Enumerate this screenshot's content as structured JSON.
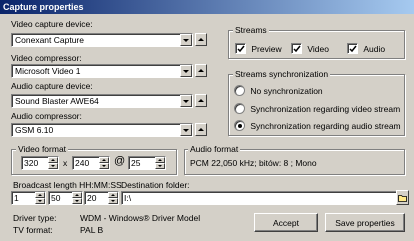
{
  "window": {
    "title": "Capture properties"
  },
  "video_device": {
    "label": "Video capture device:",
    "value": "Conexant Capture"
  },
  "video_compressor": {
    "label": "Video compressor:",
    "value": "Microsoft Video 1"
  },
  "audio_device": {
    "label": "Audio capture device:",
    "value": "Sound Blaster AWE64"
  },
  "audio_compressor": {
    "label": "Audio compressor:",
    "value": "GSM 6.10"
  },
  "streams": {
    "title": "Streams",
    "preview": {
      "label": "Preview",
      "checked": true
    },
    "video": {
      "label": "Video",
      "checked": true
    },
    "audio": {
      "label": "Audio",
      "checked": true
    }
  },
  "sync": {
    "title": "Streams synchronization",
    "options": [
      {
        "label": "No synchronization",
        "selected": false
      },
      {
        "label": "Synchronization regarding video stream",
        "selected": false
      },
      {
        "label": "Synchronization regarding audio stream",
        "selected": true
      }
    ]
  },
  "video_format": {
    "title": "Video format",
    "width": "320",
    "x_sep": "x",
    "height": "240",
    "at_sep": "@",
    "fps": "25"
  },
  "audio_format": {
    "title": "Audio format",
    "value": "PCM 22,050 kHz; bitów: 8 ; Mono"
  },
  "broadcast": {
    "label": "Broadcast length HH:MM:SS",
    "hh": "1",
    "mm": "50",
    "ss": "20"
  },
  "destination": {
    "label": "Destination folder:",
    "value": "I:\\"
  },
  "driver": {
    "type_label": "Driver type:",
    "type_value": "WDM - Windows® Driver Model",
    "tv_label": "TV format:",
    "tv_value": "PAL B"
  },
  "buttons": {
    "accept": "Accept",
    "save": "Save properties"
  }
}
